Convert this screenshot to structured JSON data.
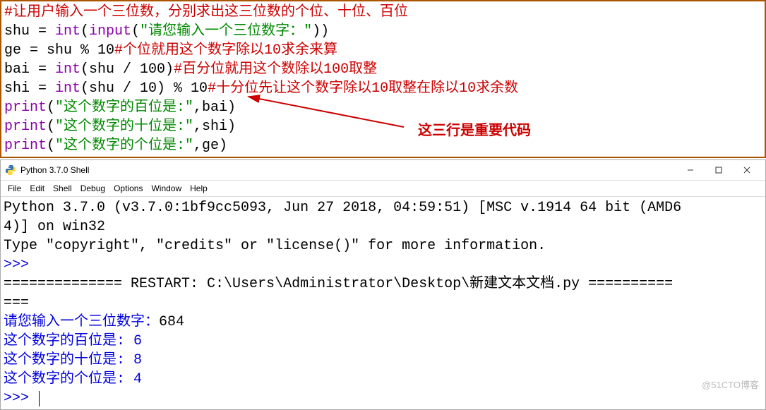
{
  "code": {
    "l1_comment": "#让用户输入一个三位数，分别求出这三位数的个位、十位、百位",
    "l2_pre": "shu = ",
    "l2_int": "int",
    "l2_paren1": "(",
    "l2_input": "input",
    "l2_paren2": "(",
    "l2_str": "\"请您输入一个三位数字：\"",
    "l2_close": "))",
    "l3_pre": "ge = shu % 10",
    "l3_comment": "#个位就用这个数字除以10求余来算",
    "l4_pre": "bai = ",
    "l4_int": "int",
    "l4_mid": "(shu / 100)",
    "l4_comment": "#百分位就用这个数除以100取整",
    "l5_pre": "shi = ",
    "l5_int": "int",
    "l5_mid": "(shu / 10) % 10",
    "l5_comment": "#十分位先让这个数字除以10取整在除以10求余数",
    "l6_print": "print",
    "l6_paren": "(",
    "l6_str": "\"这个数字的百位是:\"",
    "l6_rest": ",bai)",
    "l7_str": "\"这个数字的十位是:\"",
    "l7_rest": ",shi)",
    "l8_str": "\"这个数字的个位是:\"",
    "l8_rest": ",ge)"
  },
  "annotation": {
    "text": "这三行是重要代码"
  },
  "shell": {
    "title": "Python 3.7.0 Shell",
    "menu": [
      "File",
      "Edit",
      "Shell",
      "Debug",
      "Options",
      "Window",
      "Help"
    ],
    "banner1": "Python 3.7.0 (v3.7.0:1bf9cc5093, Jun 27 2018, 04:59:51) [MSC v.1914 64 bit (AMD6",
    "banner2": "4)] on win32",
    "banner3": "Type \"copyright\", \"credits\" or \"license()\" for more information.",
    "prompt": ">>> ",
    "restart1": "============== RESTART: C:\\Users\\Administrator\\Desktop\\新建文本文档.py ==========",
    "restart2": "===",
    "inprompt": "请您输入一个三位数字：",
    "input": "684",
    "out1": "这个数字的百位是: 6",
    "out2": "这个数字的十位是: 8",
    "out3": "这个数字的个位是: 4"
  },
  "watermark": "@51CTO博客"
}
